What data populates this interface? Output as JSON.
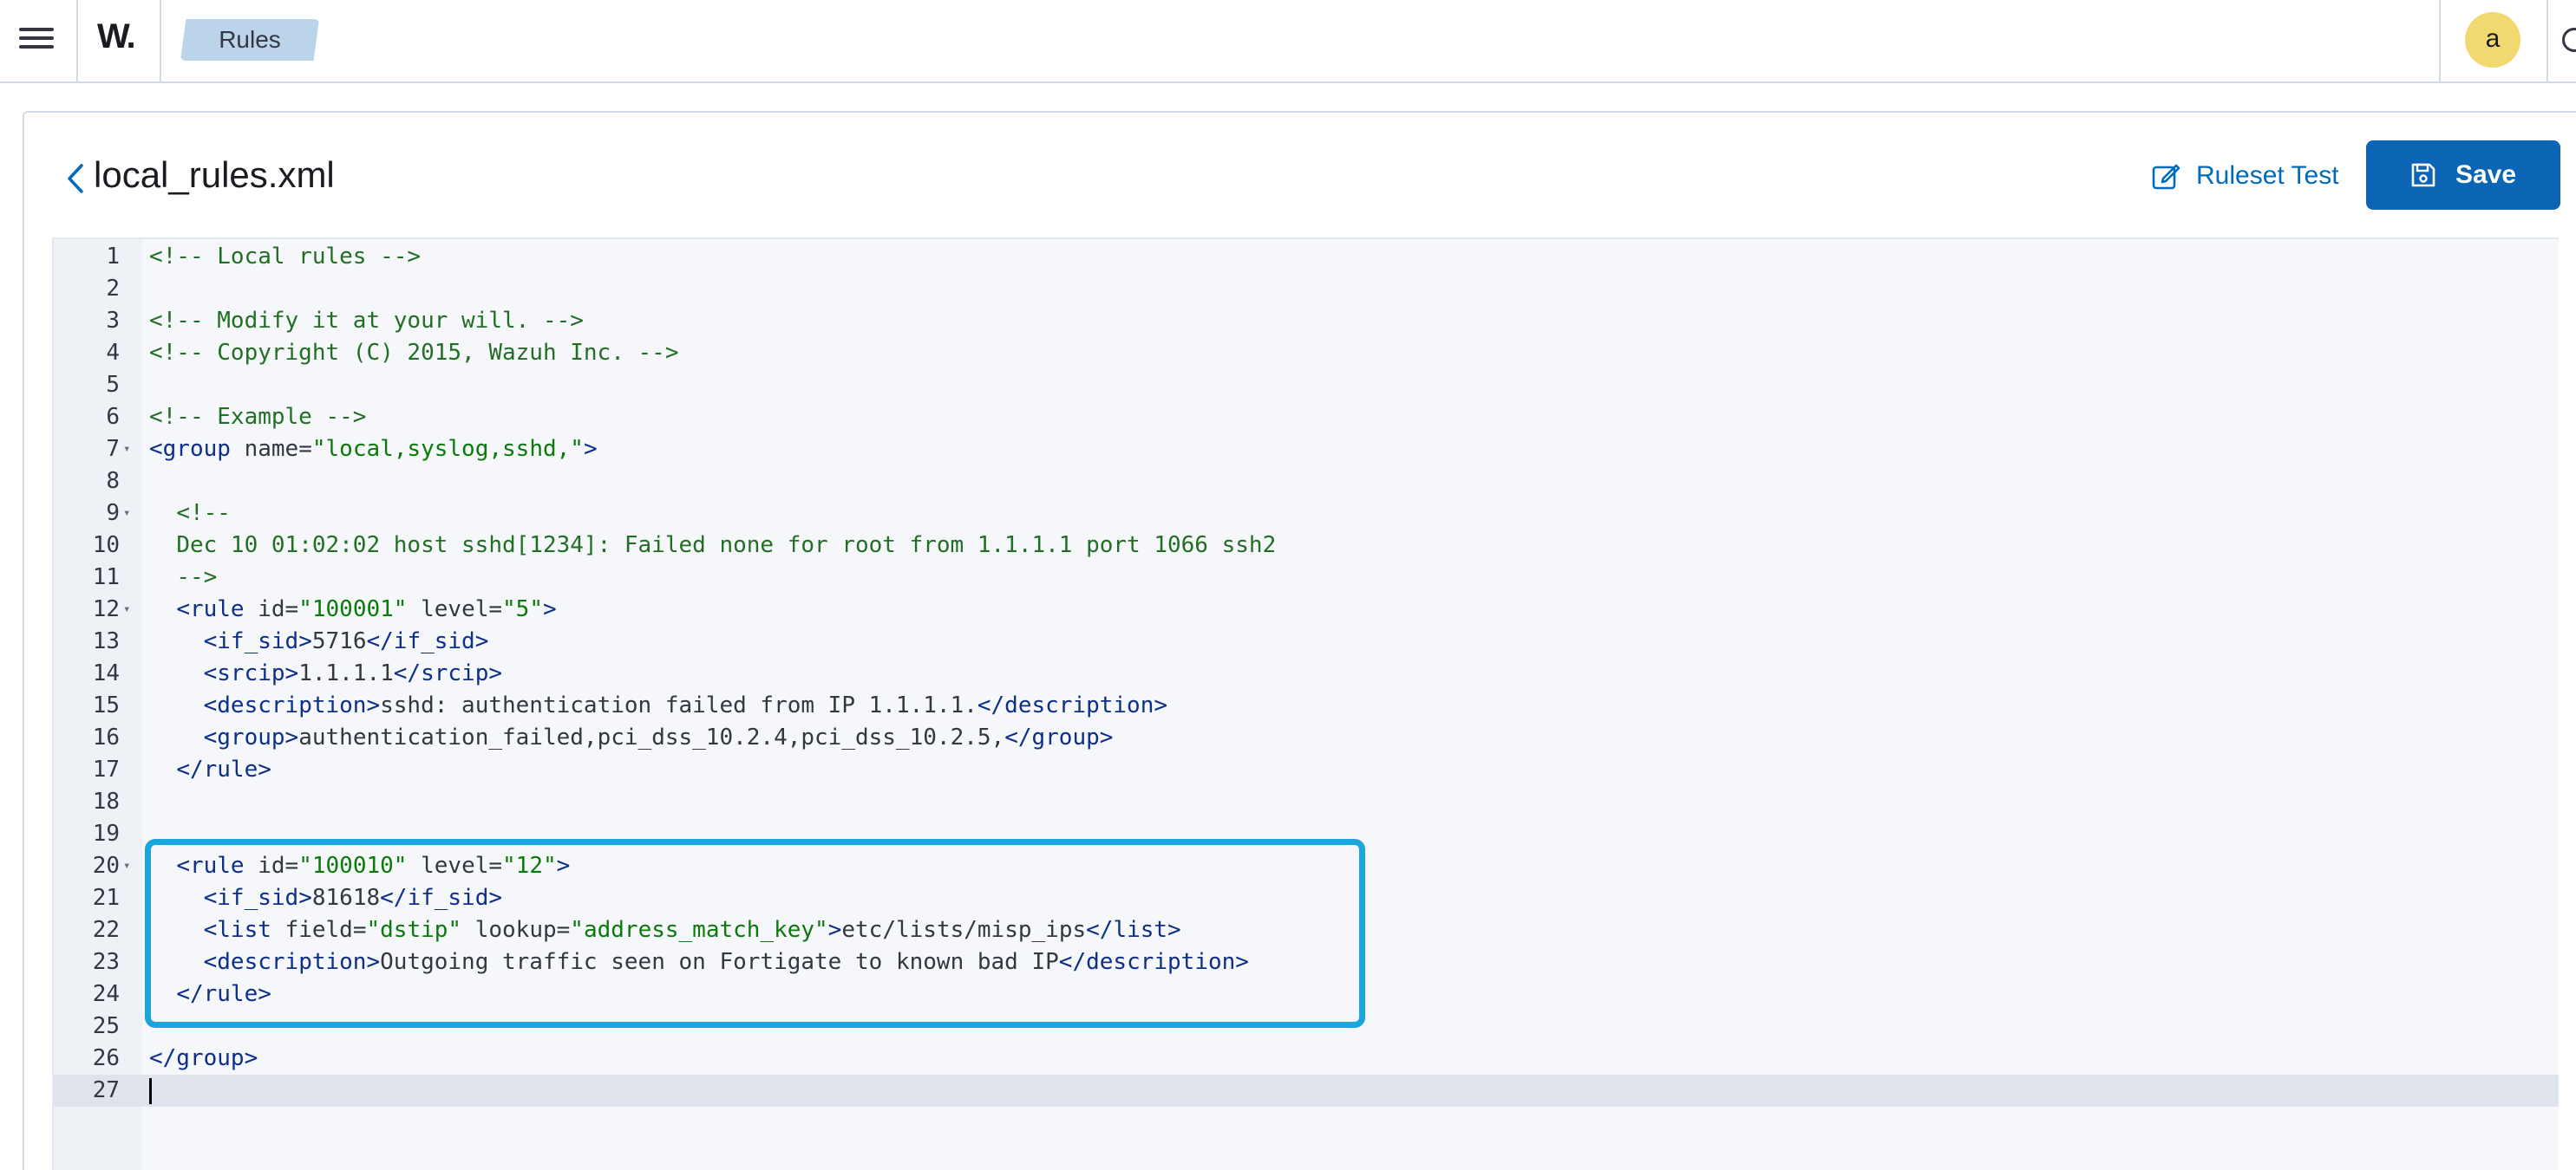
{
  "topbar": {
    "logo_text": "W.",
    "breadcrumb": "Rules",
    "avatar_letter": "a"
  },
  "header": {
    "file_title": "local_rules.xml",
    "ruleset_test_label": "Ruleset Test",
    "save_label": "Save"
  },
  "colors": {
    "accent": "#0b64b4",
    "highlight": "#1aa6dc",
    "avatar": "#f1d86f"
  },
  "editor": {
    "lines": [
      {
        "n": "1",
        "fold": "",
        "html": "<span class='c-comment'>&lt;!-- Local rules --&gt;</span>"
      },
      {
        "n": "2",
        "fold": "",
        "html": ""
      },
      {
        "n": "3",
        "fold": "",
        "html": "<span class='c-comment'>&lt;!-- Modify it at your will. --&gt;</span>"
      },
      {
        "n": "4",
        "fold": "",
        "html": "<span class='c-comment'>&lt;!-- Copyright (C) 2015, Wazuh Inc. --&gt;</span>"
      },
      {
        "n": "5",
        "fold": "",
        "html": ""
      },
      {
        "n": "6",
        "fold": "",
        "html": "<span class='c-comment'>&lt;!-- Example --&gt;</span>"
      },
      {
        "n": "7",
        "fold": "▾",
        "html": "<span class='c-tag'>&lt;group</span> <span class='c-attr'>name=</span><span class='c-val'>\"local,syslog,sshd,\"</span><span class='c-tag'>&gt;</span>"
      },
      {
        "n": "8",
        "fold": "",
        "html": ""
      },
      {
        "n": "9",
        "fold": "▾",
        "html": "  <span class='c-comment'>&lt;!--</span>"
      },
      {
        "n": "10",
        "fold": "",
        "html": "  <span class='c-comment'>Dec 10 01:02:02 host sshd[1234]: Failed none for root from 1.1.1.1 port 1066 ssh2</span>"
      },
      {
        "n": "11",
        "fold": "",
        "html": "  <span class='c-comment'>--&gt;</span>"
      },
      {
        "n": "12",
        "fold": "▾",
        "html": "  <span class='c-tag'>&lt;rule</span> <span class='c-attr'>id=</span><span class='c-val'>\"100001\"</span> <span class='c-attr'>level=</span><span class='c-val'>\"5\"</span><span class='c-tag'>&gt;</span>"
      },
      {
        "n": "13",
        "fold": "",
        "html": "    <span class='c-tag'>&lt;if_sid&gt;</span>5716<span class='c-tag'>&lt;/if_sid&gt;</span>"
      },
      {
        "n": "14",
        "fold": "",
        "html": "    <span class='c-tag'>&lt;srcip&gt;</span>1.1.1.1<span class='c-tag'>&lt;/srcip&gt;</span>"
      },
      {
        "n": "15",
        "fold": "",
        "html": "    <span class='c-tag'>&lt;description&gt;</span>sshd: authentication failed from IP 1.1.1.1.<span class='c-tag'>&lt;/description&gt;</span>"
      },
      {
        "n": "16",
        "fold": "",
        "html": "    <span class='c-tag'>&lt;group&gt;</span>authentication_failed,pci_dss_10.2.4,pci_dss_10.2.5,<span class='c-tag'>&lt;/group&gt;</span>"
      },
      {
        "n": "17",
        "fold": "",
        "html": "  <span class='c-tag'>&lt;/rule&gt;</span>"
      },
      {
        "n": "18",
        "fold": "",
        "html": ""
      },
      {
        "n": "19",
        "fold": "",
        "html": ""
      },
      {
        "n": "20",
        "fold": "▾",
        "html": "  <span class='c-tag'>&lt;rule</span> <span class='c-attr'>id=</span><span class='c-val'>\"100010\"</span> <span class='c-attr'>level=</span><span class='c-val'>\"12\"</span><span class='c-tag'>&gt;</span>"
      },
      {
        "n": "21",
        "fold": "",
        "html": "    <span class='c-tag'>&lt;if_sid&gt;</span>81618<span class='c-tag'>&lt;/if_sid&gt;</span>"
      },
      {
        "n": "22",
        "fold": "",
        "html": "    <span class='c-tag'>&lt;list</span> <span class='c-attr'>field=</span><span class='c-val'>\"dstip\"</span> <span class='c-attr'>lookup=</span><span class='c-val'>\"address_match_key\"</span><span class='c-tag'>&gt;</span>etc/lists/misp_ips<span class='c-tag'>&lt;/list&gt;</span>"
      },
      {
        "n": "23",
        "fold": "",
        "html": "    <span class='c-tag'>&lt;description&gt;</span>Outgoing traffic seen on Fortigate to known bad IP<span class='c-tag'>&lt;/description&gt;</span>"
      },
      {
        "n": "24",
        "fold": "",
        "html": "  <span class='c-tag'>&lt;/rule&gt;</span>"
      },
      {
        "n": "25",
        "fold": "",
        "html": ""
      },
      {
        "n": "26",
        "fold": "",
        "html": "<span class='c-tag'>&lt;/group&gt;</span>"
      },
      {
        "n": "27",
        "fold": "",
        "html": "<span class='cursor'></span>",
        "active": true
      }
    ]
  }
}
